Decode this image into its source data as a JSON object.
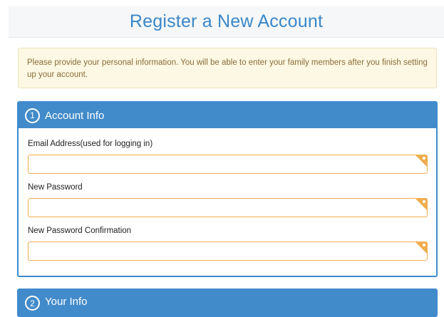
{
  "header": {
    "title": "Register a New Account"
  },
  "notice": {
    "text": "Please provide your personal information. You will be able to enter your family members after you finish setting up your account."
  },
  "account_panel": {
    "step": "1",
    "title": "Account Info",
    "fields": [
      {
        "label": "Email Address(used for logging in)",
        "value": "",
        "required": true
      },
      {
        "label": "New Password",
        "value": "",
        "required": true
      },
      {
        "label": "New Password Confirmation",
        "value": "",
        "required": true
      }
    ]
  },
  "info_panel": {
    "step": "2",
    "title": "Your Info"
  },
  "colors": {
    "accent": "#428bca",
    "title": "#3a87c8",
    "required": "#f0ad4e",
    "notice_bg": "#fcf8e3",
    "notice_text": "#8a6d3b"
  }
}
